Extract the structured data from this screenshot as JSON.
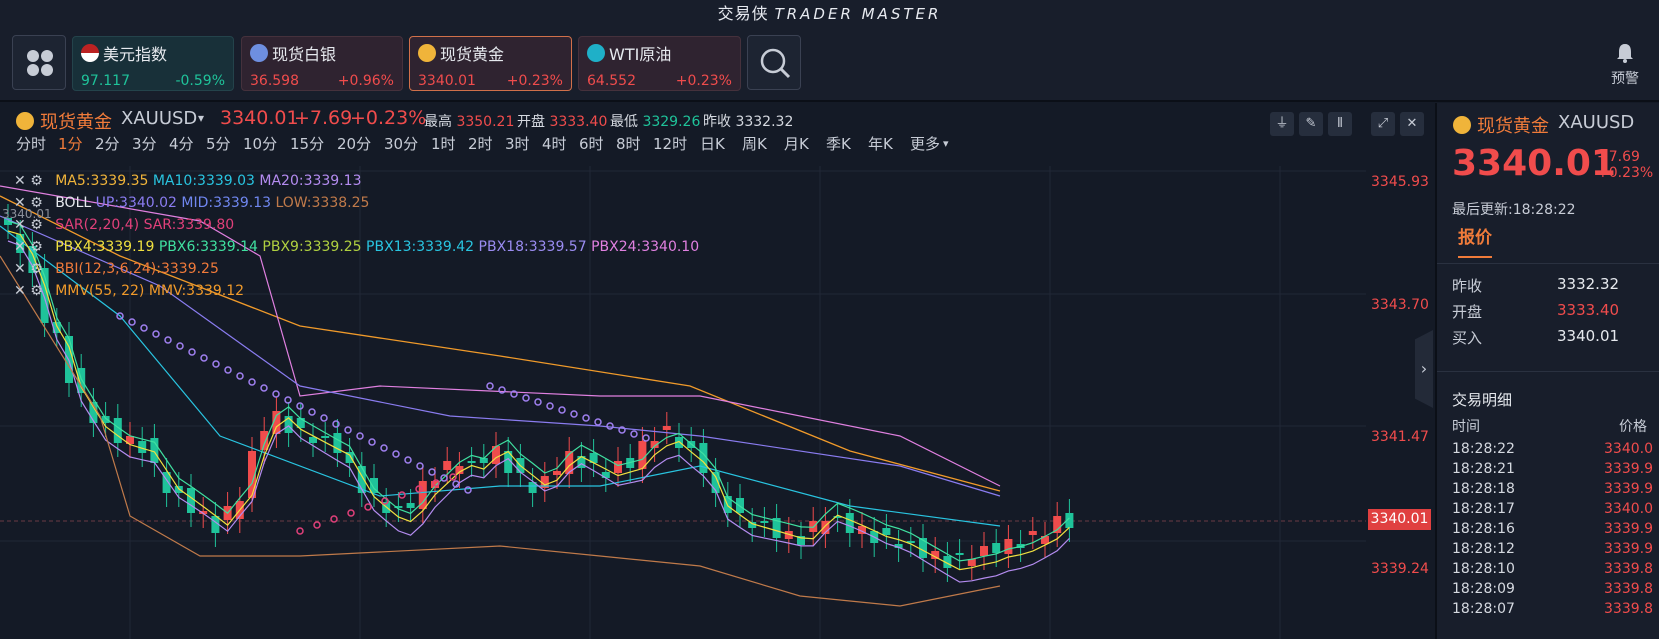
{
  "app": {
    "title_cn": "交易侠",
    "title_en": "TRADER MASTER"
  },
  "header": {
    "cards": [
      {
        "name": "美元指数",
        "price": "97.117",
        "change": "-0.59%",
        "trend": "down"
      },
      {
        "name": "现货白银",
        "price": "36.598",
        "change": "+0.96%",
        "trend": "up"
      },
      {
        "name": "现货黄金",
        "price": "3340.01",
        "change": "+0.23%",
        "trend": "up"
      },
      {
        "name": "WTI原油",
        "price": "64.552",
        "change": "+0.23%",
        "trend": "up"
      }
    ],
    "alarm_label": "预警"
  },
  "symbol_bar": {
    "name": "现货黄金",
    "code": "XAUUSD",
    "price": "3340.01",
    "change": "+7.69",
    "change_pct": "+0.23%",
    "high_label": "最高",
    "high": "3350.21",
    "open_label": "开盘",
    "open": "3333.40",
    "low_label": "最低",
    "low": "3329.26",
    "prev_label": "昨收",
    "prev": "3332.32"
  },
  "timeframes": [
    "分时",
    "1分",
    "2分",
    "3分",
    "4分",
    "5分",
    "10分",
    "15分",
    "20分",
    "30分",
    "1时",
    "2时",
    "3时",
    "4时",
    "6时",
    "8时",
    "12时",
    "日K",
    "周K",
    "月K",
    "季K",
    "年K",
    "更多"
  ],
  "active_timeframe": "1分",
  "indicators": {
    "ma": {
      "ma5": "MA5:3339.35",
      "ma10": "MA10:3339.03",
      "ma20": "MA20:3339.13"
    },
    "boll": {
      "label": "BOLL",
      "up": "UP:3340.02",
      "mid": "MID:3339.13",
      "low": "LOW:3338.25"
    },
    "sar": {
      "label": "SAR(2,20,4)",
      "val": "SAR:3339.80"
    },
    "pbx": {
      "p4": "PBX4:3339.19",
      "p6": "PBX6:3339.14",
      "p9": "PBX9:3339.25",
      "p13": "PBX13:3339.42",
      "p18": "PBX18:3339.57",
      "p24": "PBX24:3340.10"
    },
    "bbi": "BBI(12,3,6,24):3339.25",
    "mmv": {
      "label": "MMV(55, 22)",
      "val": "MMV:3339.12"
    },
    "overlap_text": "3340.01"
  },
  "price_axis": {
    "ticks": [
      "3345.93",
      "3343.70",
      "3341.47",
      "3339.24"
    ],
    "current": "3340.01"
  },
  "right_panel": {
    "name": "现货黄金",
    "code": "XAUUSD",
    "price": "3340.01",
    "change": "+7.69",
    "change_pct": "+0.23%",
    "updated": "最后更新:18:28:22",
    "tab": "报价",
    "quotes": [
      {
        "k": "昨收",
        "v": "3332.32",
        "c": "#e6e9ee"
      },
      {
        "k": "开盘",
        "v": "3333.40",
        "c": "#f04c4c"
      },
      {
        "k": "买入",
        "v": "3340.01",
        "c": "#e6e9ee"
      }
    ],
    "trades_title": "交易明细",
    "col_time": "时间",
    "col_price": "价格",
    "trades": [
      {
        "t": "18:28:22",
        "p": "3340.0"
      },
      {
        "t": "18:28:21",
        "p": "3339.9"
      },
      {
        "t": "18:28:18",
        "p": "3339.9"
      },
      {
        "t": "18:28:17",
        "p": "3340.0"
      },
      {
        "t": "18:28:16",
        "p": "3339.9"
      },
      {
        "t": "18:28:12",
        "p": "3339.9"
      },
      {
        "t": "18:28:10",
        "p": "3339.8"
      },
      {
        "t": "18:28:09",
        "p": "3339.8"
      },
      {
        "t": "18:28:07",
        "p": "3339.8"
      }
    ]
  },
  "colors": {
    "up": "#f04c4c",
    "down": "#1fc39a",
    "bg": "#141a26",
    "panel": "#181e2b"
  }
}
